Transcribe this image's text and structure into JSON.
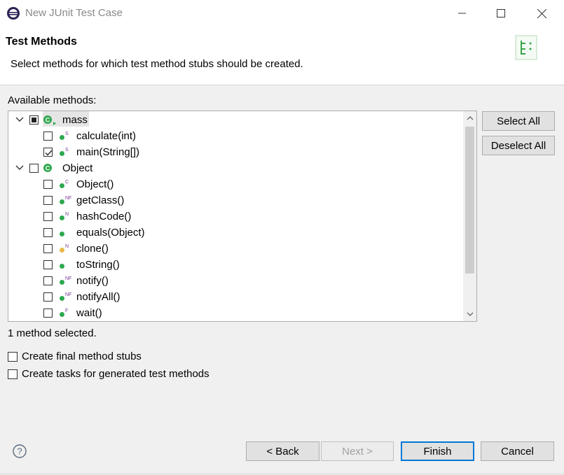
{
  "window": {
    "title": "New JUnit Test Case"
  },
  "header": {
    "title": "Test Methods",
    "description": "Select methods for which test method stubs should be created."
  },
  "tree": {
    "label": "Available methods:",
    "nodes": [
      {
        "label": "mass",
        "badge": "",
        "checked": "partial",
        "expanded": true,
        "kind": "class",
        "level": 0
      },
      {
        "label": "calculate(int)",
        "badge": "S",
        "checked": false,
        "kind": "method-public",
        "level": 1
      },
      {
        "label": "main(String[])",
        "badge": "S",
        "checked": true,
        "kind": "method-public",
        "level": 1
      },
      {
        "label": "Object",
        "badge": "",
        "checked": false,
        "expanded": true,
        "kind": "class",
        "level": 0
      },
      {
        "label": "Object()",
        "badge": "C",
        "checked": false,
        "kind": "method-public",
        "level": 1
      },
      {
        "label": "getClass()",
        "badge": "NF",
        "checked": false,
        "kind": "method-public",
        "level": 1
      },
      {
        "label": "hashCode()",
        "badge": "N",
        "checked": false,
        "kind": "method-public",
        "level": 1
      },
      {
        "label": "equals(Object)",
        "badge": "",
        "checked": false,
        "kind": "method-public",
        "level": 1
      },
      {
        "label": "clone()",
        "badge": "N",
        "checked": false,
        "kind": "method-protected",
        "level": 1
      },
      {
        "label": "toString()",
        "badge": "",
        "checked": false,
        "kind": "method-public",
        "level": 1
      },
      {
        "label": "notify()",
        "badge": "NF",
        "checked": false,
        "kind": "method-public",
        "level": 1
      },
      {
        "label": "notifyAll()",
        "badge": "NF",
        "checked": false,
        "kind": "method-public",
        "level": 1
      },
      {
        "label": "wait()",
        "badge": "F",
        "checked": false,
        "kind": "method-public",
        "level": 1
      }
    ]
  },
  "side_buttons": {
    "select_all": "Select All",
    "deselect_all": "Deselect All"
  },
  "status": "1 method selected.",
  "options": {
    "final_stubs": "Create final method stubs",
    "create_tasks": "Create tasks for generated test methods"
  },
  "footer": {
    "back": "< Back",
    "next": "Next >",
    "finish": "Finish",
    "cancel": "Cancel"
  },
  "colors": {
    "accent": "#0078d7",
    "method_public": "#2fa84f",
    "method_protected": "#e8b84a",
    "class_icon": "#2fa84f"
  }
}
